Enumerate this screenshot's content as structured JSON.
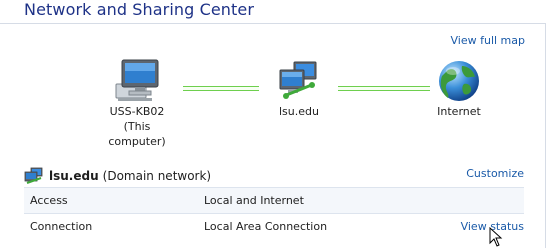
{
  "header": {
    "title": "Network and Sharing Center"
  },
  "map": {
    "view_full_map_label": "View full map",
    "nodes": [
      {
        "line1": "USS-KB02",
        "line2": "(This computer)",
        "icon": "computer-icon"
      },
      {
        "line1": "lsu.edu",
        "line2": "",
        "icon": "network-icon"
      },
      {
        "line1": "Internet",
        "line2": "",
        "icon": "globe-icon"
      }
    ]
  },
  "network": {
    "name": "lsu.edu",
    "type": "(Domain network)",
    "customize_label": "Customize",
    "rows": [
      {
        "key": "Access",
        "value": "Local and Internet",
        "action": ""
      },
      {
        "key": "Connection",
        "value": "Local Area Connection",
        "action": "View status"
      }
    ]
  },
  "colors": {
    "title": "#1e3287",
    "link": "#1a5aa8",
    "connector": "#6ecf4e"
  }
}
